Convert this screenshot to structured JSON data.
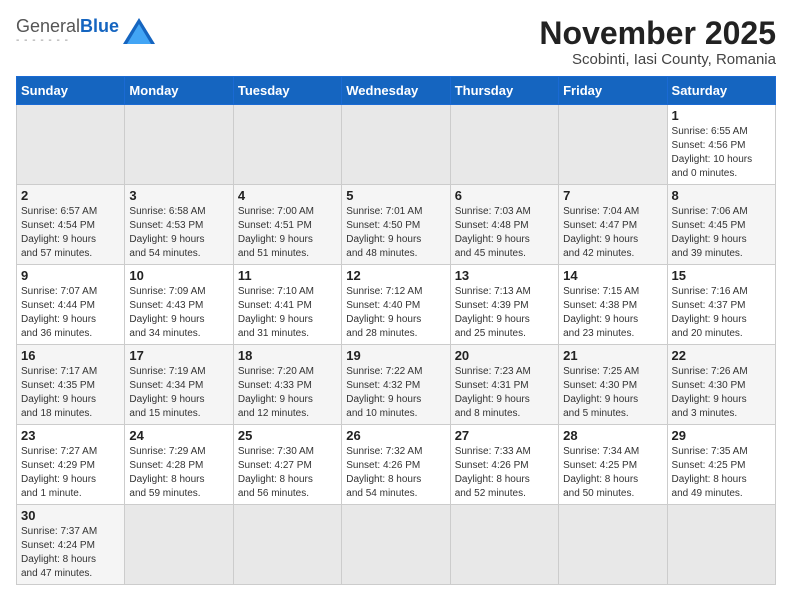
{
  "header": {
    "logo_general": "General",
    "logo_blue": "Blue",
    "month_title": "November 2025",
    "location": "Scobinti, Iasi County, Romania"
  },
  "weekdays": [
    "Sunday",
    "Monday",
    "Tuesday",
    "Wednesday",
    "Thursday",
    "Friday",
    "Saturday"
  ],
  "weeks": [
    [
      {
        "day": "",
        "info": ""
      },
      {
        "day": "",
        "info": ""
      },
      {
        "day": "",
        "info": ""
      },
      {
        "day": "",
        "info": ""
      },
      {
        "day": "",
        "info": ""
      },
      {
        "day": "",
        "info": ""
      },
      {
        "day": "1",
        "info": "Sunrise: 6:55 AM\nSunset: 4:56 PM\nDaylight: 10 hours\nand 0 minutes."
      }
    ],
    [
      {
        "day": "2",
        "info": "Sunrise: 6:57 AM\nSunset: 4:54 PM\nDaylight: 9 hours\nand 57 minutes."
      },
      {
        "day": "3",
        "info": "Sunrise: 6:58 AM\nSunset: 4:53 PM\nDaylight: 9 hours\nand 54 minutes."
      },
      {
        "day": "4",
        "info": "Sunrise: 7:00 AM\nSunset: 4:51 PM\nDaylight: 9 hours\nand 51 minutes."
      },
      {
        "day": "5",
        "info": "Sunrise: 7:01 AM\nSunset: 4:50 PM\nDaylight: 9 hours\nand 48 minutes."
      },
      {
        "day": "6",
        "info": "Sunrise: 7:03 AM\nSunset: 4:48 PM\nDaylight: 9 hours\nand 45 minutes."
      },
      {
        "day": "7",
        "info": "Sunrise: 7:04 AM\nSunset: 4:47 PM\nDaylight: 9 hours\nand 42 minutes."
      },
      {
        "day": "8",
        "info": "Sunrise: 7:06 AM\nSunset: 4:45 PM\nDaylight: 9 hours\nand 39 minutes."
      }
    ],
    [
      {
        "day": "9",
        "info": "Sunrise: 7:07 AM\nSunset: 4:44 PM\nDaylight: 9 hours\nand 36 minutes."
      },
      {
        "day": "10",
        "info": "Sunrise: 7:09 AM\nSunset: 4:43 PM\nDaylight: 9 hours\nand 34 minutes."
      },
      {
        "day": "11",
        "info": "Sunrise: 7:10 AM\nSunset: 4:41 PM\nDaylight: 9 hours\nand 31 minutes."
      },
      {
        "day": "12",
        "info": "Sunrise: 7:12 AM\nSunset: 4:40 PM\nDaylight: 9 hours\nand 28 minutes."
      },
      {
        "day": "13",
        "info": "Sunrise: 7:13 AM\nSunset: 4:39 PM\nDaylight: 9 hours\nand 25 minutes."
      },
      {
        "day": "14",
        "info": "Sunrise: 7:15 AM\nSunset: 4:38 PM\nDaylight: 9 hours\nand 23 minutes."
      },
      {
        "day": "15",
        "info": "Sunrise: 7:16 AM\nSunset: 4:37 PM\nDaylight: 9 hours\nand 20 minutes."
      }
    ],
    [
      {
        "day": "16",
        "info": "Sunrise: 7:17 AM\nSunset: 4:35 PM\nDaylight: 9 hours\nand 18 minutes."
      },
      {
        "day": "17",
        "info": "Sunrise: 7:19 AM\nSunset: 4:34 PM\nDaylight: 9 hours\nand 15 minutes."
      },
      {
        "day": "18",
        "info": "Sunrise: 7:20 AM\nSunset: 4:33 PM\nDaylight: 9 hours\nand 12 minutes."
      },
      {
        "day": "19",
        "info": "Sunrise: 7:22 AM\nSunset: 4:32 PM\nDaylight: 9 hours\nand 10 minutes."
      },
      {
        "day": "20",
        "info": "Sunrise: 7:23 AM\nSunset: 4:31 PM\nDaylight: 9 hours\nand 8 minutes."
      },
      {
        "day": "21",
        "info": "Sunrise: 7:25 AM\nSunset: 4:30 PM\nDaylight: 9 hours\nand 5 minutes."
      },
      {
        "day": "22",
        "info": "Sunrise: 7:26 AM\nSunset: 4:30 PM\nDaylight: 9 hours\nand 3 minutes."
      }
    ],
    [
      {
        "day": "23",
        "info": "Sunrise: 7:27 AM\nSunset: 4:29 PM\nDaylight: 9 hours\nand 1 minute."
      },
      {
        "day": "24",
        "info": "Sunrise: 7:29 AM\nSunset: 4:28 PM\nDaylight: 8 hours\nand 59 minutes."
      },
      {
        "day": "25",
        "info": "Sunrise: 7:30 AM\nSunset: 4:27 PM\nDaylight: 8 hours\nand 56 minutes."
      },
      {
        "day": "26",
        "info": "Sunrise: 7:32 AM\nSunset: 4:26 PM\nDaylight: 8 hours\nand 54 minutes."
      },
      {
        "day": "27",
        "info": "Sunrise: 7:33 AM\nSunset: 4:26 PM\nDaylight: 8 hours\nand 52 minutes."
      },
      {
        "day": "28",
        "info": "Sunrise: 7:34 AM\nSunset: 4:25 PM\nDaylight: 8 hours\nand 50 minutes."
      },
      {
        "day": "29",
        "info": "Sunrise: 7:35 AM\nSunset: 4:25 PM\nDaylight: 8 hours\nand 49 minutes."
      }
    ],
    [
      {
        "day": "30",
        "info": "Sunrise: 7:37 AM\nSunset: 4:24 PM\nDaylight: 8 hours\nand 47 minutes."
      },
      {
        "day": "",
        "info": ""
      },
      {
        "day": "",
        "info": ""
      },
      {
        "day": "",
        "info": ""
      },
      {
        "day": "",
        "info": ""
      },
      {
        "day": "",
        "info": ""
      },
      {
        "day": "",
        "info": ""
      }
    ]
  ]
}
